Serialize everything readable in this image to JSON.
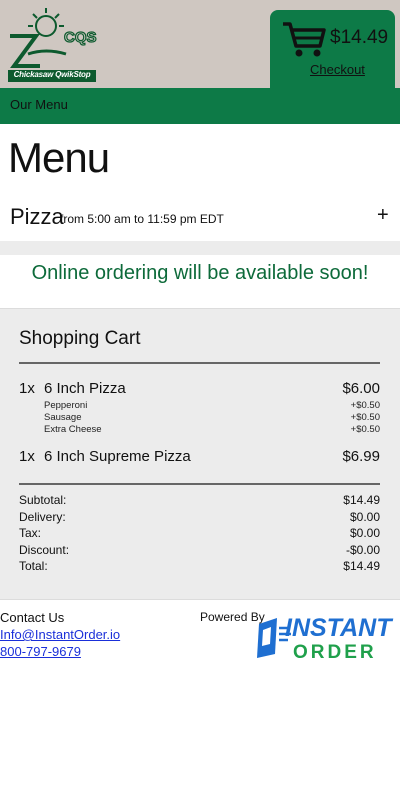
{
  "header": {
    "logo_text": "Chickasaw QwikStop",
    "logo_letters": "CQS",
    "cart_total": "$14.49",
    "checkout_label": "Checkout"
  },
  "nav": {
    "item": "Our Menu"
  },
  "menu": {
    "title": "Menu",
    "category": {
      "name": "Pizza",
      "hours": "from 5:00 am to 11:59 pm EDT",
      "toggle": "+"
    },
    "notice": "Online ordering will be available soon!"
  },
  "cart": {
    "title": "Shopping Cart",
    "items": [
      {
        "qty": "1x",
        "name": "6 Inch Pizza",
        "price": "$6.00",
        "modifiers": [
          {
            "name": "Pepperoni",
            "price": "+$0.50"
          },
          {
            "name": "Sausage",
            "price": "+$0.50"
          },
          {
            "name": "Extra Cheese",
            "price": "+$0.50"
          }
        ]
      },
      {
        "qty": "1x",
        "name": "6 Inch Supreme Pizza",
        "price": "$6.99"
      }
    ],
    "summary": [
      {
        "label": "Subtotal:",
        "value": "$14.49"
      },
      {
        "label": "Delivery:",
        "value": "$0.00"
      },
      {
        "label": "Tax:",
        "value": "$0.00"
      },
      {
        "label": "Discount:",
        "value": "-$0.00"
      },
      {
        "label": "Total:",
        "value": "$14.49"
      }
    ]
  },
  "footer": {
    "contact_label": "Contact Us",
    "email": "Info@InstantOrder.io",
    "phone": "800-797-9679",
    "powered_by": "Powered By",
    "brand_line1": "INSTANT",
    "brand_line2": "ORDER"
  },
  "colors": {
    "brand_green": "#0d7a47",
    "header_bg": "#cfc7c1",
    "link_blue": "#1a2fd9",
    "brand_blue": "#1f6fd1"
  }
}
